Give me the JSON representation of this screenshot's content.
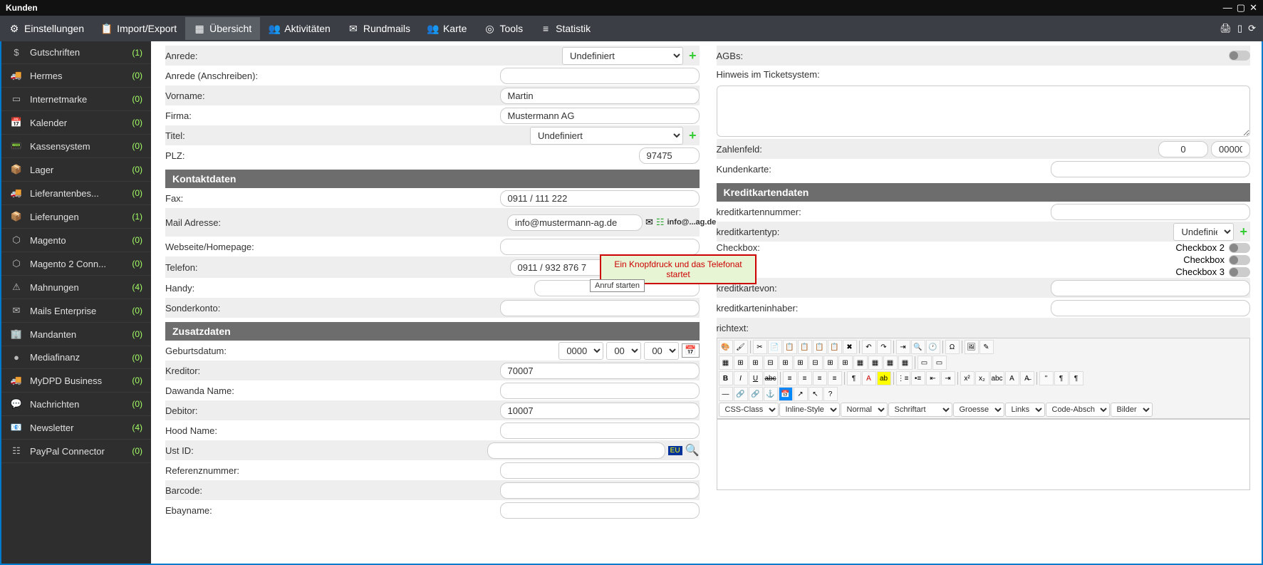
{
  "window": {
    "title": "Kunden"
  },
  "menubar": {
    "items": [
      {
        "label": "Einstellungen"
      },
      {
        "label": "Import/Export"
      },
      {
        "label": "Übersicht"
      },
      {
        "label": "Aktivitäten"
      },
      {
        "label": "Rundmails"
      },
      {
        "label": "Karte"
      },
      {
        "label": "Tools"
      },
      {
        "label": "Statistik"
      }
    ]
  },
  "sidebar": {
    "items": [
      {
        "label": "Gutschriften",
        "count": "(1)"
      },
      {
        "label": "Hermes",
        "count": "(0)"
      },
      {
        "label": "Internetmarke",
        "count": "(0)"
      },
      {
        "label": "Kalender",
        "count": "(0)"
      },
      {
        "label": "Kassensystem",
        "count": "(0)"
      },
      {
        "label": "Lager",
        "count": "(0)"
      },
      {
        "label": "Lieferantenbes...",
        "count": "(0)"
      },
      {
        "label": "Lieferungen",
        "count": "(1)"
      },
      {
        "label": "Magento",
        "count": "(0)"
      },
      {
        "label": "Magento 2 Conn...",
        "count": "(0)"
      },
      {
        "label": "Mahnungen",
        "count": "(4)"
      },
      {
        "label": "Mails Enterprise",
        "count": "(0)"
      },
      {
        "label": "Mandanten",
        "count": "(0)"
      },
      {
        "label": "Mediafinanz",
        "count": "(0)"
      },
      {
        "label": "MyDPD Business",
        "count": "(0)"
      },
      {
        "label": "Nachrichten",
        "count": "(0)"
      },
      {
        "label": "Newsletter",
        "count": "(4)"
      },
      {
        "label": "PayPal Connector",
        "count": "(0)"
      }
    ]
  },
  "form": {
    "anrede": {
      "label": "Anrede:",
      "value": "Undefiniert"
    },
    "anrede_anschreiben": {
      "label": "Anrede (Anschreiben):",
      "value": ""
    },
    "vorname": {
      "label": "Vorname:",
      "value": "Martin"
    },
    "firma": {
      "label": "Firma:",
      "value": "Mustermann AG"
    },
    "titel": {
      "label": "Titel:",
      "value": "Undefiniert"
    },
    "plz": {
      "label": "PLZ:",
      "value": "97475"
    },
    "section_kontakt": "Kontaktdaten",
    "fax": {
      "label": "Fax:",
      "value": "0911 / 111 222"
    },
    "mail": {
      "label": "Mail Adresse:",
      "value": "info@mustermann-ag.de",
      "badge": "info@...ag.de"
    },
    "webseite": {
      "label": "Webseite/Homepage:",
      "value": ""
    },
    "telefon": {
      "label": "Telefon:",
      "value": "0911 / 932 876 7"
    },
    "handy": {
      "label": "Handy:",
      "value": ""
    },
    "sonderkonto": {
      "label": "Sonderkonto:",
      "value": ""
    },
    "section_zusatz": "Zusatzdaten",
    "geburtsdatum": {
      "label": "Geburtsdatum:",
      "y": "0000",
      "m": "00",
      "d": "00"
    },
    "kreditor": {
      "label": "Kreditor:",
      "value": "70007"
    },
    "dawanda": {
      "label": "Dawanda Name:",
      "value": ""
    },
    "debitor": {
      "label": "Debitor:",
      "value": "10007"
    },
    "hood": {
      "label": "Hood Name:",
      "value": ""
    },
    "ustid": {
      "label": "Ust ID:",
      "value": ""
    },
    "referenz": {
      "label": "Referenznummer:",
      "value": ""
    },
    "barcode": {
      "label": "Barcode:",
      "value": ""
    },
    "ebayname": {
      "label": "Ebayname:",
      "value": ""
    }
  },
  "right": {
    "agbs": {
      "label": "AGBs:"
    },
    "hinweis": {
      "label": "Hinweis im Ticketsystem:",
      "value": ""
    },
    "zahlenfeld": {
      "label": "Zahlenfeld:",
      "v1": "0",
      "v2": "00000"
    },
    "kundenkarte": {
      "label": "Kundenkarte:",
      "value": ""
    },
    "section_kk": "Kreditkartendaten",
    "kknummer": {
      "label": "kreditkartennummer:",
      "value": ""
    },
    "kktyp": {
      "label": "kreditkartentyp:",
      "value": "Undefiniert"
    },
    "checkbox": {
      "label": "Checkbox:",
      "cb2": "Checkbox 2",
      "cb": "Checkbox",
      "cb3": "Checkbox 3"
    },
    "kkvon": {
      "label": "kreditkartevon:",
      "value": ""
    },
    "kkinhaber": {
      "label": "kreditkarteninhaber:",
      "value": ""
    },
    "richtext": {
      "label": "richtext:"
    }
  },
  "rt_selects": {
    "css": "CSS-Class",
    "inline": "Inline-Style",
    "normal": "Normal",
    "schrift": "Schriftart",
    "groesse": "Groesse",
    "links": "Links",
    "code": "Code-Abschnitt",
    "bilder": "Bilder"
  },
  "callout": "Ein Knopfdruck und das Telefonat startet",
  "tooltip": "Anruf starten"
}
